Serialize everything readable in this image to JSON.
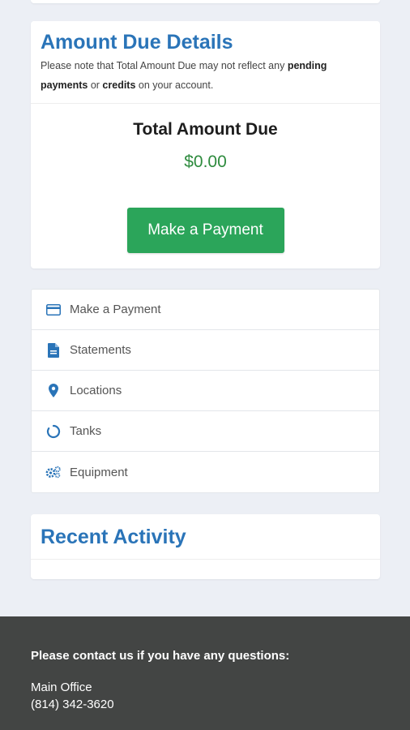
{
  "amount_due": {
    "title": "Amount Due Details",
    "note_prefix": "Please note that Total Amount Due may not reflect any ",
    "note_bold1": "pending payments",
    "note_mid": " or ",
    "note_bold2": "credits",
    "note_suffix": " on your account.",
    "total_label": "Total Amount Due",
    "total_value": "$0.00",
    "button_label": "Make a Payment"
  },
  "nav": {
    "items": [
      {
        "label": "Make a Payment",
        "icon": "credit-card-icon"
      },
      {
        "label": "Statements",
        "icon": "document-icon"
      },
      {
        "label": "Locations",
        "icon": "map-pin-icon"
      },
      {
        "label": "Tanks",
        "icon": "circle-notch-icon"
      },
      {
        "label": "Equipment",
        "icon": "gears-icon"
      }
    ]
  },
  "recent_activity": {
    "title": "Recent Activity"
  },
  "footer": {
    "heading": "Please contact us if you have any questions:",
    "office": "Main Office",
    "phone": "(814) 342-3620"
  },
  "colors": {
    "accent": "#2a74b8",
    "success": "#2ba55a",
    "amount": "#2e8b3e",
    "footer_bg": "#434544"
  }
}
